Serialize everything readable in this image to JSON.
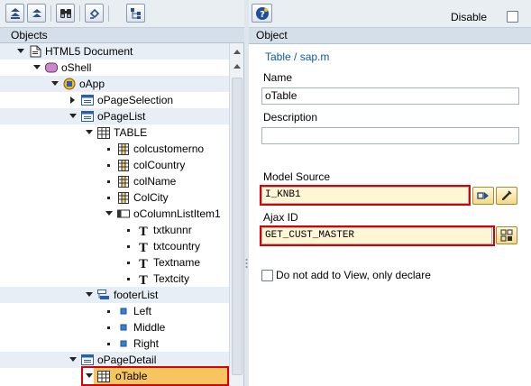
{
  "left_panel": {
    "header": "Objects",
    "toolbar": [
      {
        "icon": "expand-all-icon"
      },
      {
        "icon": "collapse-all-icon"
      },
      {
        "icon": "binoculars-icon"
      },
      {
        "icon": "undo-icon"
      },
      {
        "icon": "hierarchy-icon"
      }
    ],
    "tree": [
      {
        "label": "HTML5 Document",
        "level": 0,
        "icon": "document-icon",
        "expander": "collapse",
        "alt": true
      },
      {
        "label": "oShell",
        "level": 1,
        "icon": "shell-icon",
        "expander": "collapse"
      },
      {
        "label": "oApp",
        "level": 2,
        "icon": "app-icon",
        "expander": "collapse",
        "alt": true
      },
      {
        "label": "oPageSelection",
        "level": 3,
        "icon": "page-icon",
        "expander": "expand"
      },
      {
        "label": "oPageList",
        "level": 3,
        "icon": "page-icon",
        "expander": "collapse",
        "alt": true
      },
      {
        "label": "TABLE",
        "level": 4,
        "icon": "table-icon",
        "expander": "collapse"
      },
      {
        "label": "colcustomerno",
        "level": 5,
        "icon": "column-icon",
        "expander": "bullet"
      },
      {
        "label": "colCountry",
        "level": 5,
        "icon": "column-icon",
        "expander": "bullet"
      },
      {
        "label": "colName",
        "level": 5,
        "icon": "column-icon",
        "expander": "bullet"
      },
      {
        "label": "ColCity",
        "level": 5,
        "icon": "column-icon",
        "expander": "bullet"
      },
      {
        "label": "oColumnListItem1",
        "level": 5,
        "icon": "list-item-icon",
        "expander": "collapse"
      },
      {
        "label": "txtkunnr",
        "level": 6,
        "icon": "text-icon",
        "expander": "bullet"
      },
      {
        "label": "txtcountry",
        "level": 6,
        "icon": "text-icon",
        "expander": "bullet"
      },
      {
        "label": "Textname",
        "level": 6,
        "icon": "text-icon",
        "expander": "bullet"
      },
      {
        "label": "Textcity",
        "level": 6,
        "icon": "text-icon",
        "expander": "bullet"
      },
      {
        "label": "footerList",
        "level": 4,
        "icon": "footer-icon",
        "expander": "collapse",
        "alt": true
      },
      {
        "label": "Left",
        "level": 5,
        "icon": "small-square-icon",
        "expander": "bullet"
      },
      {
        "label": "Middle",
        "level": 5,
        "icon": "small-square-icon",
        "expander": "bullet"
      },
      {
        "label": "Right",
        "level": 5,
        "icon": "small-square-icon",
        "expander": "bullet"
      },
      {
        "label": "oPageDetail",
        "level": 3,
        "icon": "page-icon",
        "expander": "collapse",
        "alt": true
      },
      {
        "label": "oTable",
        "level": 4,
        "icon": "table-icon",
        "expander": "collapse",
        "selected": true
      }
    ]
  },
  "right_panel": {
    "disable_label": "Disable",
    "disable_checked": false,
    "header": "Object",
    "type_link": "Table / sap.m",
    "name_label": "Name",
    "name_value": "oTable",
    "description_label": "Description",
    "description_value": "",
    "model_source_label": "Model Source",
    "model_source_value": "I_KNB1",
    "ajax_id_label": "Ajax ID",
    "ajax_id_value": "GET_CUST_MASTER",
    "declare_label": "Do not add to View, only declare",
    "declare_checked": false
  },
  "colors": {
    "highlight_border": "#d80000",
    "selected_row": "#f6c55f",
    "link": "#0a5aa8"
  }
}
